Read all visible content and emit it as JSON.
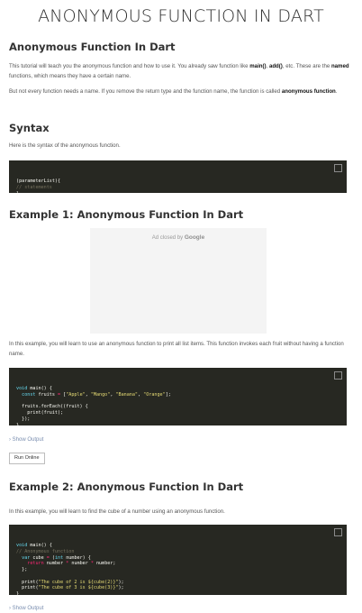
{
  "page": {
    "title": "ANONYMOUS FUNCTION IN DART"
  },
  "intro": {
    "heading": "Anonymous Function In Dart",
    "p1_a": "This tutorial will teach you the anonymous function and how to use it. You already saw function like ",
    "p1_main": "main()",
    "p1_sep": ", ",
    "p1_add": "add()",
    "p1_b": ", etc. These are the ",
    "p1_named": "named",
    "p1_c": " functions, which means they have a certain name.",
    "p2_a": "But not every function needs a name. If you remove the return type and the function name, the function is called ",
    "p2_bold": "anonymous function",
    "p2_b": "."
  },
  "syntax": {
    "heading": "Syntax",
    "text": "Here is the syntax of the anonymous function.",
    "code_lines": [
      {
        "parts": [
          {
            "t": "(parameterList){",
            "c": ""
          }
        ]
      },
      {
        "parts": [
          {
            "t": "// statements",
            "c": "c"
          }
        ]
      },
      {
        "parts": [
          {
            "t": "}",
            "c": ""
          }
        ]
      }
    ]
  },
  "example1": {
    "heading": "Example 1: Anonymous Function In Dart",
    "ad_text": "Ad closed by ",
    "ad_brand": "Google",
    "text": "In this example, you will learn to use an anonymous function to print all list items. This function invokes each fruit without having a function name.",
    "code_lines": [
      {
        "parts": [
          {
            "t": "void",
            "c": "k"
          },
          {
            "t": " main() {",
            "c": ""
          }
        ]
      },
      {
        "parts": [
          {
            "t": "  const",
            "c": "k"
          },
          {
            "t": " fruits ",
            "c": ""
          },
          {
            "t": "=",
            "c": "o"
          },
          {
            "t": " [",
            "c": ""
          },
          {
            "t": "\"Apple\"",
            "c": "s"
          },
          {
            "t": ", ",
            "c": ""
          },
          {
            "t": "\"Mango\"",
            "c": "s"
          },
          {
            "t": ", ",
            "c": ""
          },
          {
            "t": "\"Banana\"",
            "c": "s"
          },
          {
            "t": ", ",
            "c": ""
          },
          {
            "t": "\"Orange\"",
            "c": "s"
          },
          {
            "t": "];",
            "c": ""
          }
        ]
      },
      {
        "parts": [
          {
            "t": "",
            "c": ""
          }
        ]
      },
      {
        "parts": [
          {
            "t": "  fruits.forEach((fruit) {",
            "c": ""
          }
        ]
      },
      {
        "parts": [
          {
            "t": "    print(fruit);",
            "c": ""
          }
        ]
      },
      {
        "parts": [
          {
            "t": "  });",
            "c": ""
          }
        ]
      },
      {
        "parts": [
          {
            "t": "}",
            "c": ""
          }
        ]
      }
    ],
    "show_output": "Show Output",
    "run_label": "Run Online"
  },
  "example2": {
    "heading": "Example 2: Anonymous Function In Dart",
    "text": "In this example, you will learn to find the cube of a number using an anonymous function.",
    "code_lines": [
      {
        "parts": [
          {
            "t": "void",
            "c": "k"
          },
          {
            "t": " main() {",
            "c": ""
          }
        ]
      },
      {
        "parts": [
          {
            "t": "// Anonymous function",
            "c": "c"
          }
        ]
      },
      {
        "parts": [
          {
            "t": "  var",
            "c": "k"
          },
          {
            "t": " cube ",
            "c": ""
          },
          {
            "t": "=",
            "c": "o"
          },
          {
            "t": " (",
            "c": ""
          },
          {
            "t": "int",
            "c": "k"
          },
          {
            "t": " number) {",
            "c": ""
          }
        ]
      },
      {
        "parts": [
          {
            "t": "    return",
            "c": "o"
          },
          {
            "t": " number ",
            "c": ""
          },
          {
            "t": "*",
            "c": "o"
          },
          {
            "t": " number ",
            "c": ""
          },
          {
            "t": "*",
            "c": "o"
          },
          {
            "t": " number;",
            "c": ""
          }
        ]
      },
      {
        "parts": [
          {
            "t": "  };",
            "c": ""
          }
        ]
      },
      {
        "parts": [
          {
            "t": "",
            "c": ""
          }
        ]
      },
      {
        "parts": [
          {
            "t": "  print(",
            "c": ""
          },
          {
            "t": "\"The cube of 2 is ${cube(2)}\"",
            "c": "s"
          },
          {
            "t": ");",
            "c": ""
          }
        ]
      },
      {
        "parts": [
          {
            "t": "  print(",
            "c": ""
          },
          {
            "t": "\"The cube of 3 is ${cube(3)}\"",
            "c": "s"
          },
          {
            "t": ");",
            "c": ""
          }
        ]
      },
      {
        "parts": [
          {
            "t": "}",
            "c": ""
          }
        ]
      }
    ],
    "show_output": "Show Output"
  }
}
